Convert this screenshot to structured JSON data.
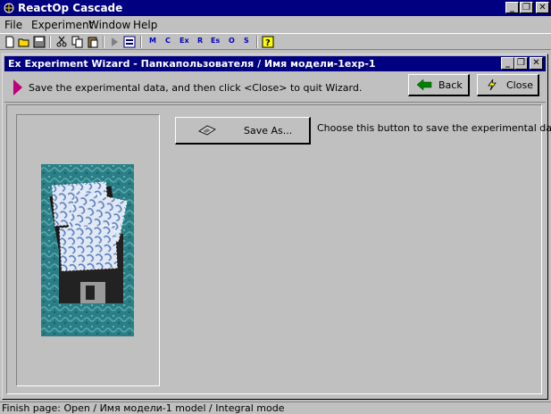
{
  "app": {
    "title": "ReactOp Cascade",
    "window_buttons": {
      "minimize": "_",
      "restore": "❐",
      "close": "✕"
    }
  },
  "menu": [
    "File",
    "Experiment",
    "Window",
    "Help"
  ],
  "toolbar": {
    "icons": [
      "new-icon",
      "open-icon",
      "save-icon",
      "cut-icon",
      "copy-icon",
      "paste-icon",
      "run-icon",
      "report-icon",
      "help-icon"
    ],
    "letter_buttons": [
      "M",
      "C",
      "Ex",
      "R",
      "Es",
      "O",
      "S"
    ]
  },
  "wizard": {
    "title": "Ex Experiment Wizard - Папкапользователя / Имя модели-1exp-1",
    "instruction": "Save the experimental data, and then click <Close> to quit Wizard.",
    "back_label": "Back",
    "close_label": "Close",
    "save_as_label": "Save As...",
    "save_as_desc": "Choose this button to save the experimental data.",
    "window_buttons": {
      "minimize": "_",
      "restore": "❐",
      "close": "✕"
    }
  },
  "status": {
    "text": "Finish page:  Open / Имя модели-1 model / Integral mode"
  },
  "colors": {
    "titlebar": "#000080",
    "face": "#c0c0c0",
    "instruction_arrow": "#c0007a",
    "back_arrow": "#008000"
  }
}
